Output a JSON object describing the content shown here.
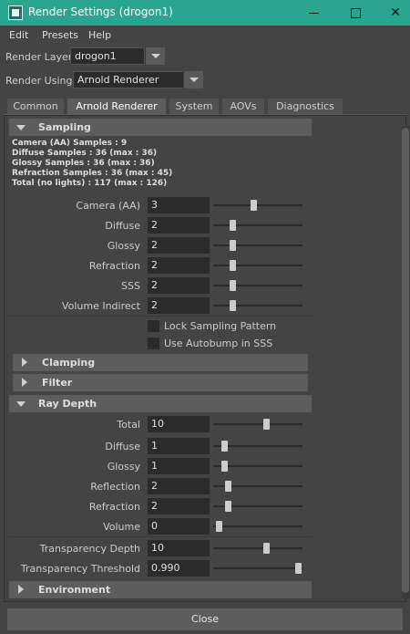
{
  "window": {
    "title": "Render Settings (drogon1)",
    "accent": "#2aa590"
  },
  "menu": [
    "Edit",
    "Presets",
    "Help"
  ],
  "render_layer": {
    "label": "Render Layer",
    "value": "drogon1"
  },
  "render_using": {
    "label": "Render Using",
    "value": "Arnold Renderer"
  },
  "tabs": [
    "Common",
    "Arnold Renderer",
    "System",
    "AOVs",
    "Diagnostics"
  ],
  "active_tab": "Arnold Renderer",
  "sampling": {
    "title": "Sampling",
    "info": [
      "Camera (AA) Samples : 9",
      "Diffuse Samples : 36 (max : 36)",
      "Glossy Samples : 36 (max : 36)",
      "Refraction Samples : 36 (max : 45)",
      "Total (no lights) : 117 (max : 126)"
    ],
    "rows": [
      {
        "label": "Camera (AA)",
        "value": "3",
        "slider": 0.45
      },
      {
        "label": "Diffuse",
        "value": "2",
        "slider": 0.2
      },
      {
        "label": "Glossy",
        "value": "2",
        "slider": 0.2
      },
      {
        "label": "Refraction",
        "value": "2",
        "slider": 0.2
      },
      {
        "label": "SSS",
        "value": "2",
        "slider": 0.2
      },
      {
        "label": "Volume Indirect",
        "value": "2",
        "slider": 0.2
      }
    ],
    "checkboxes": [
      "Lock Sampling Pattern",
      "Use Autobump in SSS"
    ]
  },
  "collapsed_sections": [
    "Clamping",
    "Filter"
  ],
  "ray_depth": {
    "title": "Ray Depth",
    "rows": [
      {
        "label": "Total",
        "value": "10",
        "slider": 0.6
      },
      {
        "label": "Diffuse",
        "value": "1",
        "slider": 0.1
      },
      {
        "label": "Glossy",
        "value": "1",
        "slider": 0.1
      },
      {
        "label": "Reflection",
        "value": "2",
        "slider": 0.14
      },
      {
        "label": "Refraction",
        "value": "2",
        "slider": 0.14
      },
      {
        "label": "Volume",
        "value": "0",
        "slider": 0.03
      },
      {
        "label": "Transparency Depth",
        "value": "10",
        "slider": 0.6
      },
      {
        "label": "Transparency Threshold",
        "value": "0.990",
        "slider": 0.99
      }
    ]
  },
  "environment": {
    "title": "Environment"
  },
  "close_label": "Close"
}
